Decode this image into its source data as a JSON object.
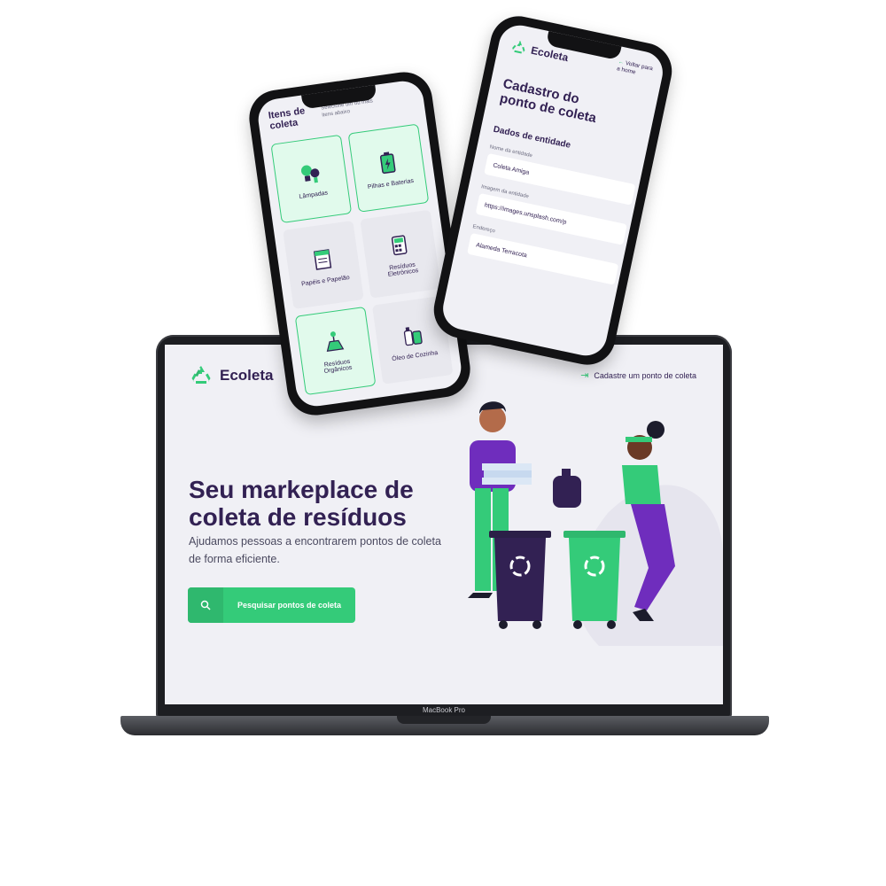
{
  "laptop": {
    "model": "MacBook Pro"
  },
  "web": {
    "logo_text": "Ecoleta",
    "cta_label": "Cadastre um ponto de coleta",
    "hero_title": "Seu markeplace de coleta de resíduos",
    "hero_subtitle": "Ajudamos pessoas a encontrarem pontos de coleta de forma eficiente.",
    "search_button_label": "Pesquisar pontos de coleta"
  },
  "phone_left": {
    "title": "Itens de coleta",
    "subtitle": "Selecione um ou mais itens abaixo",
    "items": [
      {
        "label": "Lâmpadas",
        "selected": true
      },
      {
        "label": "Pilhas e Baterias",
        "selected": true
      },
      {
        "label": "Papéis e Papelão",
        "selected": false
      },
      {
        "label": "Resíduos Eletrônicos",
        "selected": false
      },
      {
        "label": "Resíduos Orgânicos",
        "selected": true
      },
      {
        "label": "Óleo de Cozinha",
        "selected": false
      }
    ]
  },
  "phone_right": {
    "logo_text": "Ecoleta",
    "back_label": "Voltar para a home",
    "form_title": "Cadastro do ponto de coleta",
    "section_title": "Dados de entidade",
    "fields": [
      {
        "label": "Nome da entidade",
        "value": "Coleta Amiga"
      },
      {
        "label": "Imagem da entidade",
        "value": "https://images.unsplash.com/p"
      },
      {
        "label": "Endereço",
        "value": "Alameda Terracota"
      }
    ]
  },
  "colors": {
    "primary_green": "#34cb79",
    "title_purple": "#322153",
    "background": "#f0f0f5"
  }
}
